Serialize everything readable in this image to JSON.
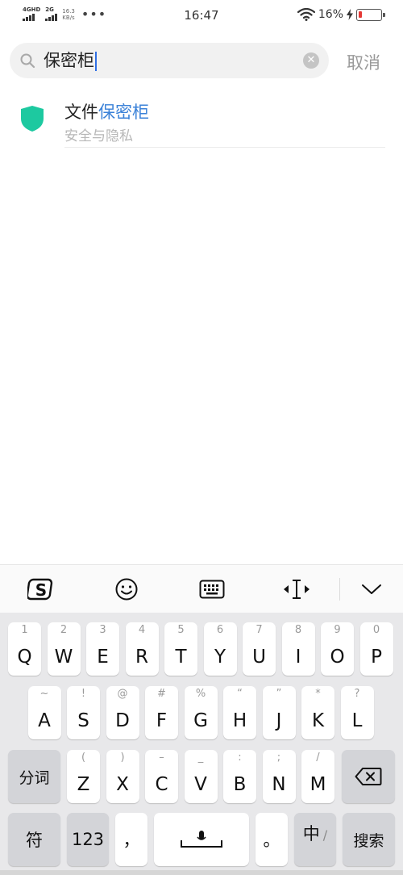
{
  "status_bar": {
    "network1": "4GHD",
    "network2": "2G",
    "speed_value": "16.3",
    "speed_unit": "KB/s",
    "more": "•••",
    "time": "16:47",
    "battery_percent": "16%",
    "battery_level": 0.16,
    "battery_color": "#e53935"
  },
  "search": {
    "query": "保密柜",
    "clear_icon": "close-circle-icon",
    "cancel_label": "取消"
  },
  "results": [
    {
      "title_prefix": "文件",
      "title_highlight": "保密柜",
      "subtitle": "安全与隐私",
      "icon": "shield-icon",
      "icon_color": "#1dc9a0",
      "highlight_color": "#3b82d8"
    }
  ],
  "keyboard_toolbar": {
    "items": [
      "sogou-logo-icon",
      "emoji-icon",
      "keyboard-icon",
      "cursor-move-icon",
      "chevron-down-icon"
    ]
  },
  "keyboard": {
    "row1": [
      {
        "main": "Q",
        "hint": "1"
      },
      {
        "main": "W",
        "hint": "2"
      },
      {
        "main": "E",
        "hint": "3"
      },
      {
        "main": "R",
        "hint": "4"
      },
      {
        "main": "T",
        "hint": "5"
      },
      {
        "main": "Y",
        "hint": "6"
      },
      {
        "main": "U",
        "hint": "7"
      },
      {
        "main": "I",
        "hint": "8"
      },
      {
        "main": "O",
        "hint": "9"
      },
      {
        "main": "P",
        "hint": "0"
      }
    ],
    "row2": [
      {
        "main": "A",
        "hint": "~"
      },
      {
        "main": "S",
        "hint": "!"
      },
      {
        "main": "D",
        "hint": "@"
      },
      {
        "main": "F",
        "hint": "#"
      },
      {
        "main": "G",
        "hint": "%"
      },
      {
        "main": "H",
        "hint": "“"
      },
      {
        "main": "J",
        "hint": "”"
      },
      {
        "main": "K",
        "hint": "*"
      },
      {
        "main": "L",
        "hint": "?"
      }
    ],
    "row3_left": "分词",
    "row3": [
      {
        "main": "Z",
        "hint": "("
      },
      {
        "main": "X",
        "hint": ")"
      },
      {
        "main": "C",
        "hint": "–"
      },
      {
        "main": "V",
        "hint": "_"
      },
      {
        "main": "B",
        "hint": ":"
      },
      {
        "main": "N",
        "hint": ";"
      },
      {
        "main": "M",
        "hint": "/"
      }
    ],
    "row3_right": "backspace-icon",
    "symbol_key": "符",
    "number_key": "123",
    "comma_key": "，",
    "space_icon": "microphone-icon",
    "period_key": "。",
    "lang_key": "中",
    "lang_sub": "/",
    "search_key": "搜索"
  }
}
